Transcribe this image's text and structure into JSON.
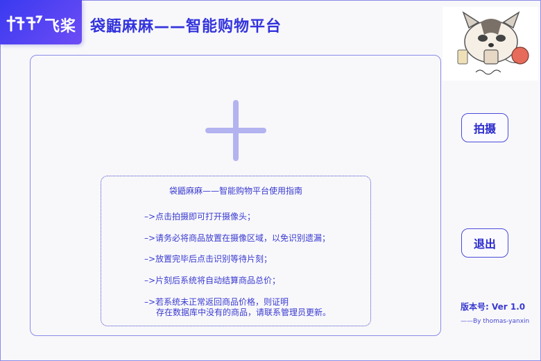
{
  "header": {
    "logo_text": "飞桨",
    "title": "袋鼯麻麻——智能购物平台"
  },
  "main": {
    "add_icon": "plus-icon",
    "guide": {
      "title": "袋鼯麻麻——智能购物平台使用指南",
      "steps": [
        "–>点击拍摄即可打开摄像头；",
        "–>请务必将商品放置在摄像区域，以免识别遗漏；",
        "–>放置完毕后点击识别等待片刻；",
        "–>片刻后系统将自动结算商品总价；",
        "–>若系统未正常返回商品价格，则证明"
      ],
      "step5_continued": "存在数据库中没有的商品，请联系管理员更新。"
    }
  },
  "sidebar": {
    "capture_label": "拍摄",
    "exit_label": "退出",
    "version": "版本号: Ver 1.0",
    "author": "——By thomas-yanxin"
  },
  "colors": {
    "accent": "#3a3ad0",
    "logo_bg": "#3a3af0",
    "plus": "#b3b3f0",
    "background": "#f8f8fb"
  }
}
